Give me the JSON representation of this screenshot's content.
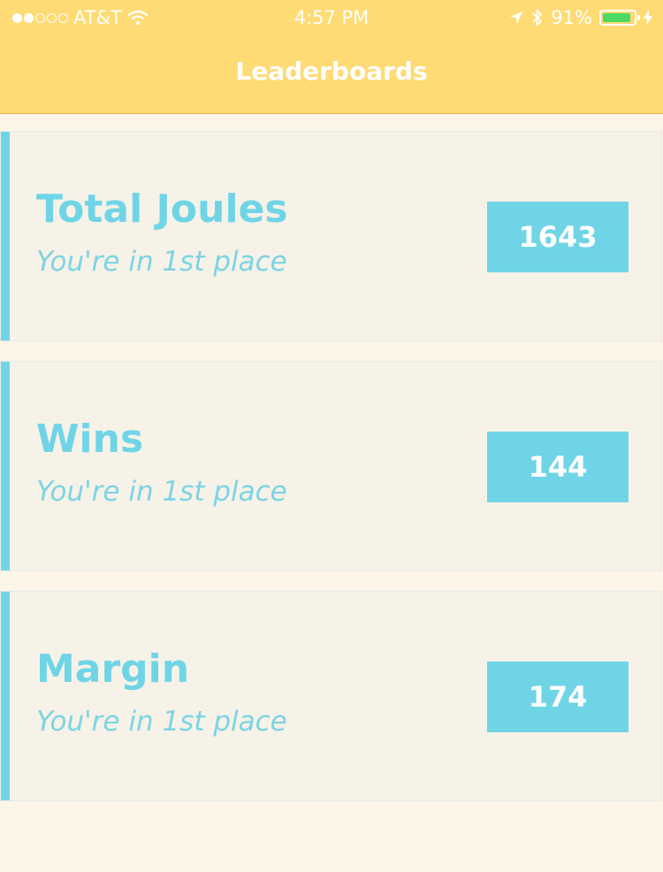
{
  "status_bar": {
    "carrier": "AT&T",
    "time": "4:57 PM",
    "battery_percent": "91%",
    "battery_level": 0.91,
    "signal_bars_filled": 2,
    "signal_bars_total": 5,
    "icons": [
      "wifi-icon",
      "location-arrow-icon",
      "bluetooth-icon",
      "battery-icon",
      "charging-bolt-icon"
    ]
  },
  "nav": {
    "title": "Leaderboards"
  },
  "leaderboards": [
    {
      "title": "Total Joules",
      "subtitle": "You're in 1st place",
      "score": "1643"
    },
    {
      "title": "Wins",
      "subtitle": "You're in 1st place",
      "score": "144"
    },
    {
      "title": "Margin",
      "subtitle": "You're in 1st place",
      "score": "174"
    }
  ],
  "colors": {
    "header_bg": "#fedb74",
    "page_bg": "#fcf5e8",
    "card_bg": "#f6f2e8",
    "accent": "#6fd5e6",
    "battery_fill": "#4cd964"
  }
}
